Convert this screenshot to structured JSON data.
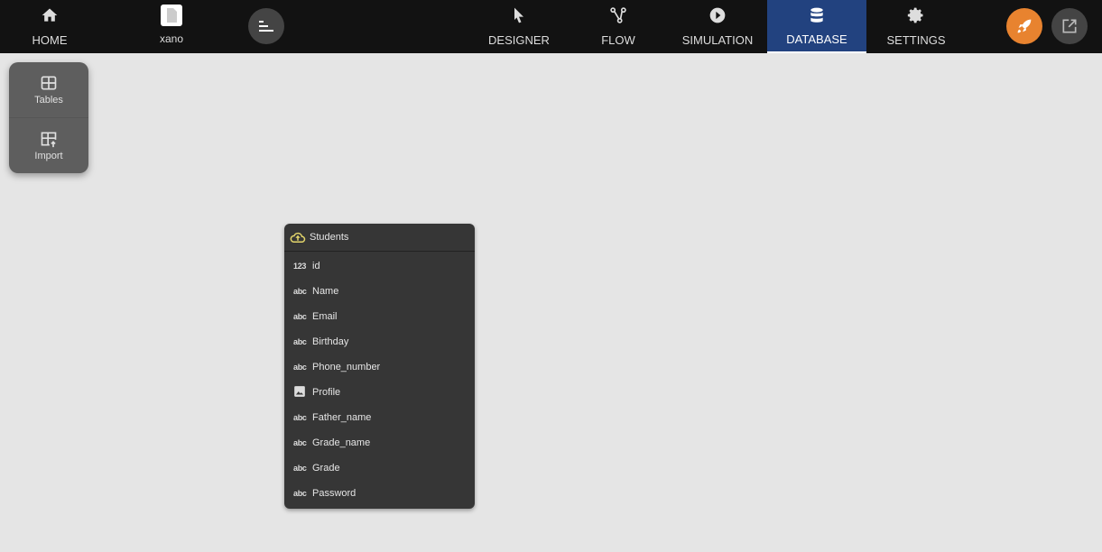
{
  "nav": {
    "home": "HOME",
    "project": "xano",
    "tabs": [
      {
        "label": "DESIGNER",
        "icon": "cursor-icon"
      },
      {
        "label": "FLOW",
        "icon": "flow-icon"
      },
      {
        "label": "SIMULATION",
        "icon": "play-icon"
      },
      {
        "label": "DATABASE",
        "icon": "database-icon",
        "active": true
      },
      {
        "label": "SETTINGS",
        "icon": "gear-icon"
      }
    ],
    "accent": "#22427f",
    "publish_color": "#e8832f"
  },
  "side": {
    "tables": "Tables",
    "import": "Import"
  },
  "table": {
    "name": "Students",
    "fields": [
      {
        "type": "123",
        "name": "id"
      },
      {
        "type": "abc",
        "name": "Name"
      },
      {
        "type": "abc",
        "name": "Email"
      },
      {
        "type": "abc",
        "name": "Birthday"
      },
      {
        "type": "abc",
        "name": "Phone_number"
      },
      {
        "type": "image",
        "name": "Profile"
      },
      {
        "type": "abc",
        "name": "Father_name"
      },
      {
        "type": "abc",
        "name": "Grade_name"
      },
      {
        "type": "abc",
        "name": "Grade"
      },
      {
        "type": "abc",
        "name": "Password"
      }
    ]
  }
}
